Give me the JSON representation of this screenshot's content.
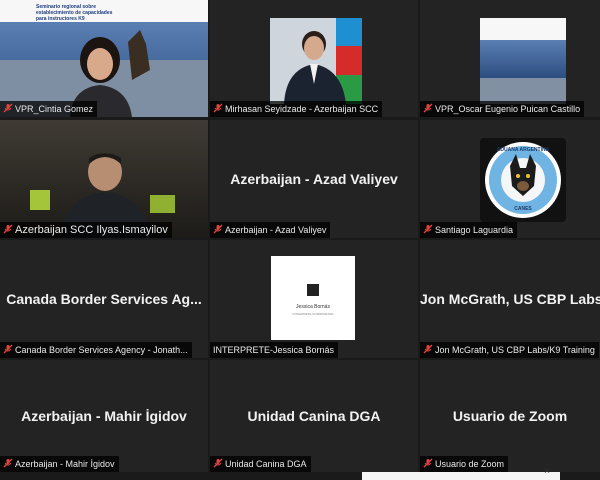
{
  "participants": [
    {
      "id": "p1",
      "label": "VPR_Cintia Gomez"
    },
    {
      "id": "p2",
      "label": "Mirhasan Seyidzade - Azerbaijan SCC"
    },
    {
      "id": "p3",
      "label": "VPR_Oscar Eugenio Puican Castillo"
    },
    {
      "id": "p4",
      "label": "Azerbaijan SCC Ilyas.Ismayilov"
    },
    {
      "id": "p5",
      "label": "Azerbaijan - Azad Valiyev",
      "center": "Azerbaijan - Azad Valiyev"
    },
    {
      "id": "p6",
      "label": "Santiago Laguardia"
    },
    {
      "id": "p7",
      "label": "Canada Border Services Agency - Jonath...",
      "center": "Canada Border Services Ag..."
    },
    {
      "id": "p8",
      "label": "INTERPRETE-Jessica Bornás",
      "card_name": "Jessica Bornás",
      "card_sub": "INTERPRETE INTERPRETER"
    },
    {
      "id": "p9",
      "label": "Jon McGrath, US CBP Labs/K9 Training",
      "center": "Jon McGrath, US CBP Labs"
    },
    {
      "id": "p10",
      "label": "Azerbaijan - Mahir İgidov",
      "center": "Azerbaijan - Mahir İgidov"
    },
    {
      "id": "p11",
      "label": "Unidad Canina DGA",
      "center": "Unidad Canina DGA"
    },
    {
      "id": "p12",
      "label": "Usuario de Zoom",
      "center": "Usuario de Zoom"
    }
  ],
  "logos": {
    "aduana_top": "ADUANA ARGENTINA",
    "aduana_bottom": "CANES"
  },
  "slides": {
    "title_line1": "Seminario regional sobre",
    "title_line2": "establecimiento de capacidades",
    "title_line3": "para instructores K9"
  },
  "colors": {
    "background": "#1a1a1a",
    "tile": "#232323",
    "mic_muted": "#e0443e"
  },
  "icons": {
    "mic": "mic-muted-icon",
    "close": "close-icon"
  },
  "close_glyph": "×"
}
